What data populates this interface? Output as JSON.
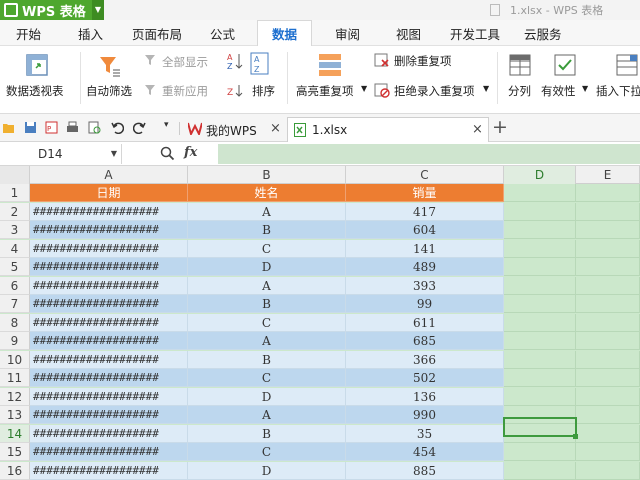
{
  "app": {
    "name": "WPS 表格",
    "document_title": "1.xlsx - WPS 表格"
  },
  "menu": {
    "tabs": [
      "开始",
      "插入",
      "页面布局",
      "公式",
      "数据",
      "审阅",
      "视图",
      "开发工具",
      "云服务"
    ],
    "active": "数据"
  },
  "ribbon": {
    "pivot": "数据透视表",
    "autofilter": "自动筛选",
    "show_all": "全部显示",
    "reapply": "重新应用",
    "sort": "排序",
    "highlight_dup": "高亮重复项",
    "remove_dup": "删除重复项",
    "reject_dup": "拒绝录入重复项",
    "split": "分列",
    "validity": "有效性",
    "insert_dropdown": "插入下拉"
  },
  "doc_tabs": {
    "home": "我的WPS",
    "file": "1.xlsx"
  },
  "formula_bar": {
    "cell_ref": "D14",
    "fx": "fx",
    "formula": ""
  },
  "columns": [
    "A",
    "B",
    "C",
    "D",
    "E"
  ],
  "headers": {
    "date": "日期",
    "name": "姓名",
    "sales": "销量"
  },
  "rows": [
    {
      "n": "1"
    },
    {
      "n": "2",
      "a": "###################",
      "b": "A",
      "c": "417"
    },
    {
      "n": "3",
      "a": "###################",
      "b": "B",
      "c": "604"
    },
    {
      "n": "4",
      "a": "###################",
      "b": "C",
      "c": "141"
    },
    {
      "n": "5",
      "a": "###################",
      "b": "D",
      "c": "489"
    },
    {
      "n": "6",
      "a": "###################",
      "b": "A",
      "c": "393"
    },
    {
      "n": "7",
      "a": "###################",
      "b": "B",
      "c": "99"
    },
    {
      "n": "8",
      "a": "###################",
      "b": "C",
      "c": "611"
    },
    {
      "n": "9",
      "a": "###################",
      "b": "A",
      "c": "685"
    },
    {
      "n": "10",
      "a": "###################",
      "b": "B",
      "c": "366"
    },
    {
      "n": "11",
      "a": "###################",
      "b": "C",
      "c": "502"
    },
    {
      "n": "12",
      "a": "###################",
      "b": "D",
      "c": "136"
    },
    {
      "n": "13",
      "a": "###################",
      "b": "A",
      "c": "990"
    },
    {
      "n": "14",
      "a": "###################",
      "b": "B",
      "c": "35"
    },
    {
      "n": "15",
      "a": "###################",
      "b": "C",
      "c": "454"
    },
    {
      "n": "16",
      "a": "###################",
      "b": "D",
      "c": "885"
    }
  ],
  "colors": {
    "header": "#ed7d31",
    "band_light": "#ddebf7",
    "band_dark": "#bdd7ee",
    "selection": "#3e9a3e",
    "eye_protect": "#cce8cc"
  }
}
